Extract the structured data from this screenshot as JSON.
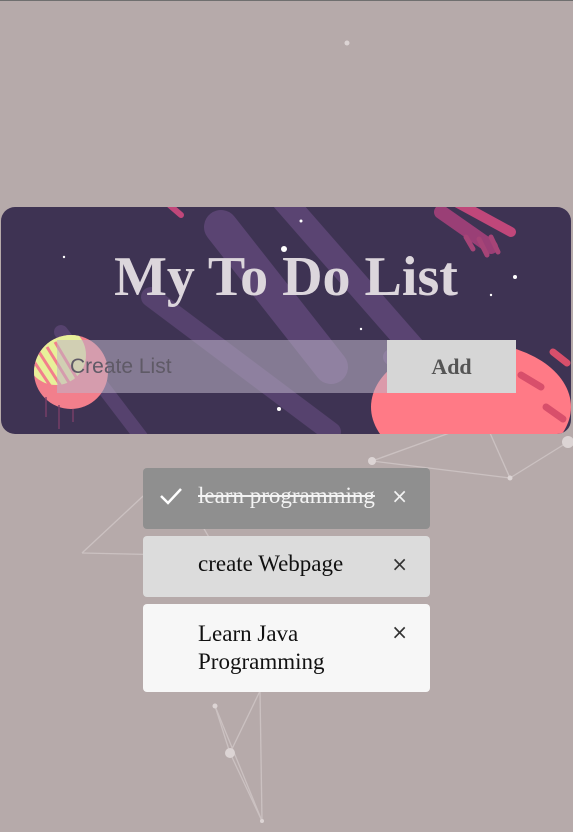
{
  "header": {
    "title": "My To Do List"
  },
  "create": {
    "placeholder": "Create List",
    "add_label": "Add"
  },
  "todos": [
    {
      "text": "learn programming",
      "checked": true,
      "close": "×"
    },
    {
      "text": "create Webpage",
      "checked": false,
      "close": "×"
    },
    {
      "text": "Learn Java Programming",
      "checked": false,
      "close": "×"
    }
  ],
  "colors": {
    "page_background": "#b6aaaa",
    "header_background": "#3e3353",
    "title": "#dcd6dc",
    "add_button": "#d6d6d6",
    "checked_item": "#8f8f8f",
    "grey_item": "#dcdcdc",
    "white_item": "#f7f7f7",
    "planet_pink": "#ff7a86"
  }
}
